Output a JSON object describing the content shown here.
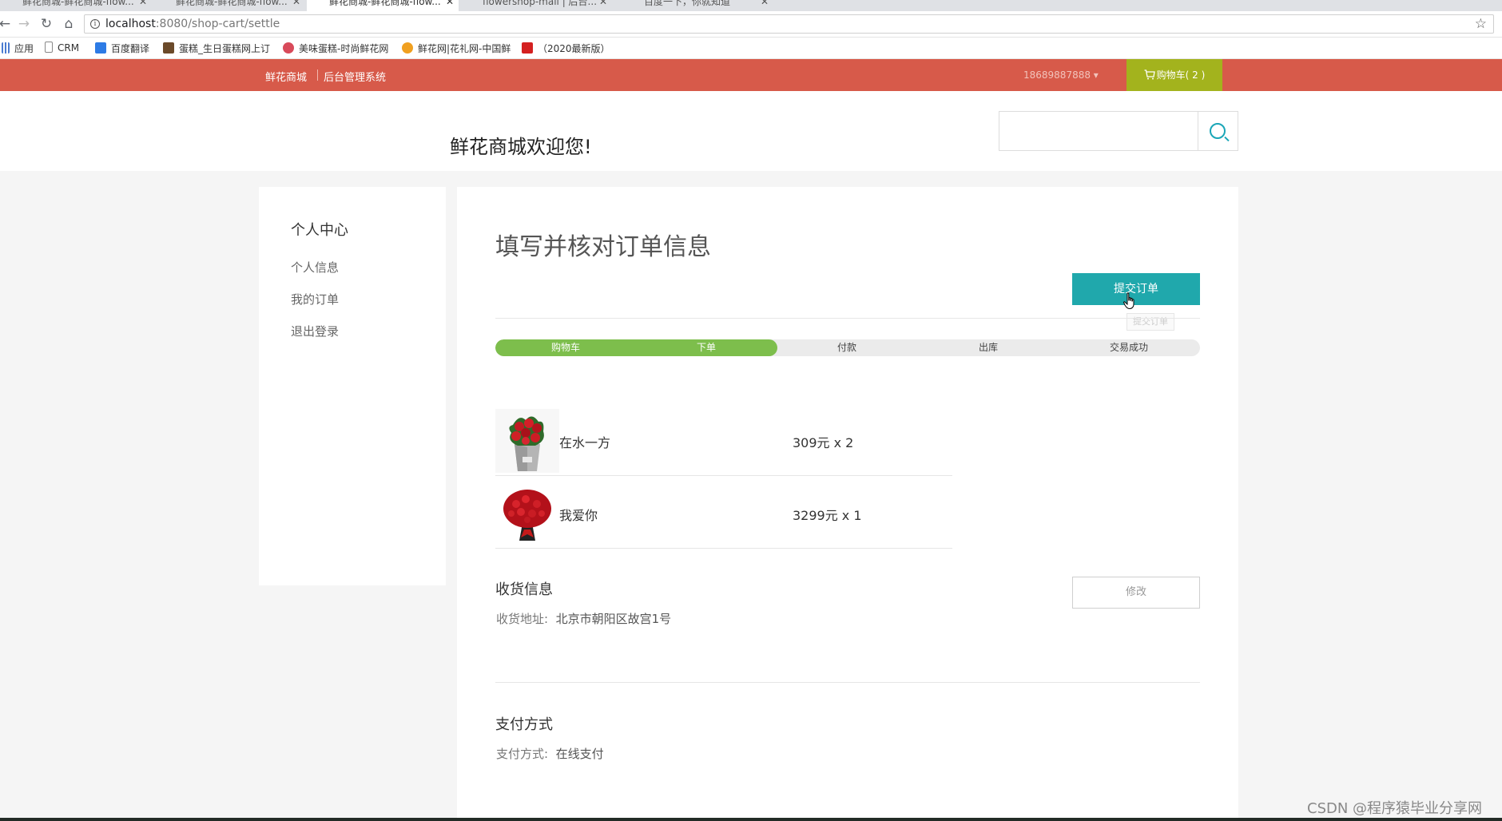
{
  "browser": {
    "tabs": [
      "鲜花商城-鲜花商城-flow...",
      "鲜花商城-鲜花商城-flow...",
      "鲜花商城-鲜花商城-flow...",
      "flowershop-mall | 后台...",
      "百度一下，你就知道"
    ],
    "url_host": "localhost",
    "url_path": ":8080/shop-cart/settle",
    "bookmarks": [
      "应用",
      "CRM",
      "百度翻译",
      "蛋糕_生日蛋糕网上订",
      "美味蛋糕-时尚鲜花网",
      "鲜花网|花礼网-中国鲜",
      "（2020最新版）"
    ]
  },
  "topbar": {
    "brand": "鲜花商城",
    "admin_link": "后台管理系统",
    "user": "18689887888 ▾",
    "cart_label": "购物车( 2 )",
    "color": "#d75a4a",
    "cart_color": "#a3b31d"
  },
  "header": {
    "welcome": "鲜花商城欢迎您!",
    "search_icon": "search-icon"
  },
  "sidebar": {
    "title": "个人中心",
    "items": [
      "个人信息",
      "我的订单",
      "退出登录"
    ]
  },
  "main": {
    "title": "填写并核对订单信息",
    "submit_label": "提交订单",
    "tooltip": "提交订单",
    "accent": "#20a8ac",
    "steps": [
      "购物车",
      "下单",
      "付款",
      "出库",
      "交易成功"
    ],
    "steps_completed": 2,
    "progress_color": "#7dbe4c",
    "items": [
      {
        "name": "在水一方",
        "price": "309元 x 2"
      },
      {
        "name": "我爱你",
        "price": "3299元 x 1"
      }
    ],
    "shipping": {
      "title": "收货信息",
      "address_label": "收货地址:",
      "address_value": "北京市朝阳区故宫1号",
      "modify_label": "修改"
    },
    "payment": {
      "title": "支付方式",
      "label": "支付方式:",
      "value": "在线支付"
    }
  },
  "watermark": "CSDN @程序猿毕业分享网"
}
